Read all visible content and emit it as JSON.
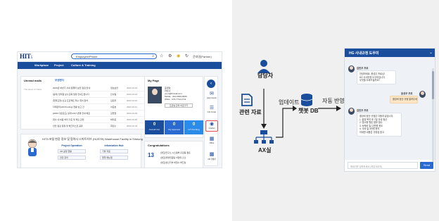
{
  "portal": {
    "logo": "HIT",
    "logo_small": "5",
    "search_placeholder": "Employee/Phone",
    "user": "윤대영(Partner)",
    "nav": [
      "Workplace",
      "Project",
      "Culture & Training"
    ],
    "unread_mails": {
      "title": "Unread mails",
      "tab": "보낸편지",
      "recent": "The latest 10 Mails",
      "rows": [
        {
          "subject": "2023년 하반기 사내 컴퓨터 보안 점검 안내",
          "sender": "정보보안",
          "date": "2023.10.23"
        },
        {
          "subject": "[공지] 임직원 보수교육 일정 안내드립니다",
          "sender": "인사팀",
          "date": "2023.10.23"
        },
        {
          "subject": "[협력요청] 신규 프로젝트 착수 회의 참석",
          "sender": "김민우",
          "date": "2023.10.22"
        },
        {
          "subject": "자재관리(AM Pooling) 현황 보고 건",
          "sender": "이준호",
          "date": "2023.10.21"
        },
        {
          "subject": "[HMS 다운로드] 설계 IAST 변경 안내 배포",
          "sender": "김현철",
          "date": "2023.10.20"
        },
        {
          "subject": "회사 내 비용 처리 기준 및 제출 관련",
          "sender": "박지은",
          "date": "2023.10.20"
        },
        {
          "subject": "안전 점검 일정 및 체크리스트 공유",
          "sender": "최민수",
          "date": "2023.10.19"
        },
        {
          "subject": "My News! 개발 시스템 개편 안내",
          "sender": "임지영",
          "date": "2023.10.18"
        }
      ]
    },
    "my_page": {
      "title": "My Page",
      "name": "윤대영",
      "role": "파트너",
      "email": "yoon@hitmail.com",
      "mobile": "Mobile : 010-0000-0000",
      "office": "Office : 070-7714-1711",
      "button": "프로필 관리 바로가기",
      "stats": [
        {
          "num": "0",
          "label": "Overall Cal."
        },
        {
          "num": "0",
          "label": "My Approval"
        },
        {
          "num": "0",
          "label": "IoT Pending"
        }
      ]
    },
    "congrats": {
      "title": "Congratulations",
      "count": "13",
      "lines": [
        "[경조]연구소 시스템부 홍길동 결혼",
        "[경조]경영지원팀 이영희 출산",
        "[경조]생산기술 박철수 부친상"
      ]
    },
    "banner": {
      "title": "HIT5 포털 현장 정보 및 협력사 스마트허브 (HUSTB) Warehouse Facility in Siheung",
      "col1_title": "Project Operation",
      "col1_items": [
        "AR 공정 현황",
        "안전 관리"
      ],
      "col2_title": "Information Hub",
      "col2_items": [
        "기술 자료",
        "업무 매뉴얼"
      ]
    },
    "quick": [
      {
        "label": "Help Center"
      },
      {
        "label": "Info Center"
      },
      {
        "label": "Chatbot"
      },
      {
        "label": "Office"
      },
      {
        "label": "AR 현황판"
      }
    ]
  },
  "flow": {
    "person": "담당자",
    "docs": "관련 자료",
    "update": "업데이트",
    "ax": "AX실",
    "db": "챗봇 DB",
    "apply": "자동 반영"
  },
  "chat": {
    "title": "HG 사내규정 도우미",
    "input_placeholder": "메세지를 입력하세요 (최대 500자)",
    "send": "Send",
    "bot_name": "김민주 프로",
    "user_name": "윤성우 프로",
    "messages": [
      {
        "from": "bot",
        "lines": [
          "안녕하세요, 윤성우 프로님!",
          "HG 사내규정 도우미입니다.",
          "무엇을 도와드릴까요?"
        ]
      },
      {
        "from": "user",
        "lines": [
          "출장비 정산 규정 알려주세요"
        ]
      },
      {
        "from": "bot",
        "lines": [
          "출장비 정산 규정은 다음과 같습니다.",
          "1. 출장 복귀 후 7일 이내 정산",
          "2. 영수증 원본 첨부 필수",
          "3. 숙박비 일 12만원 한도",
          "4. 식비 일 3만원 한도",
          "자세한 내용은 규정집 참고"
        ]
      }
    ]
  }
}
